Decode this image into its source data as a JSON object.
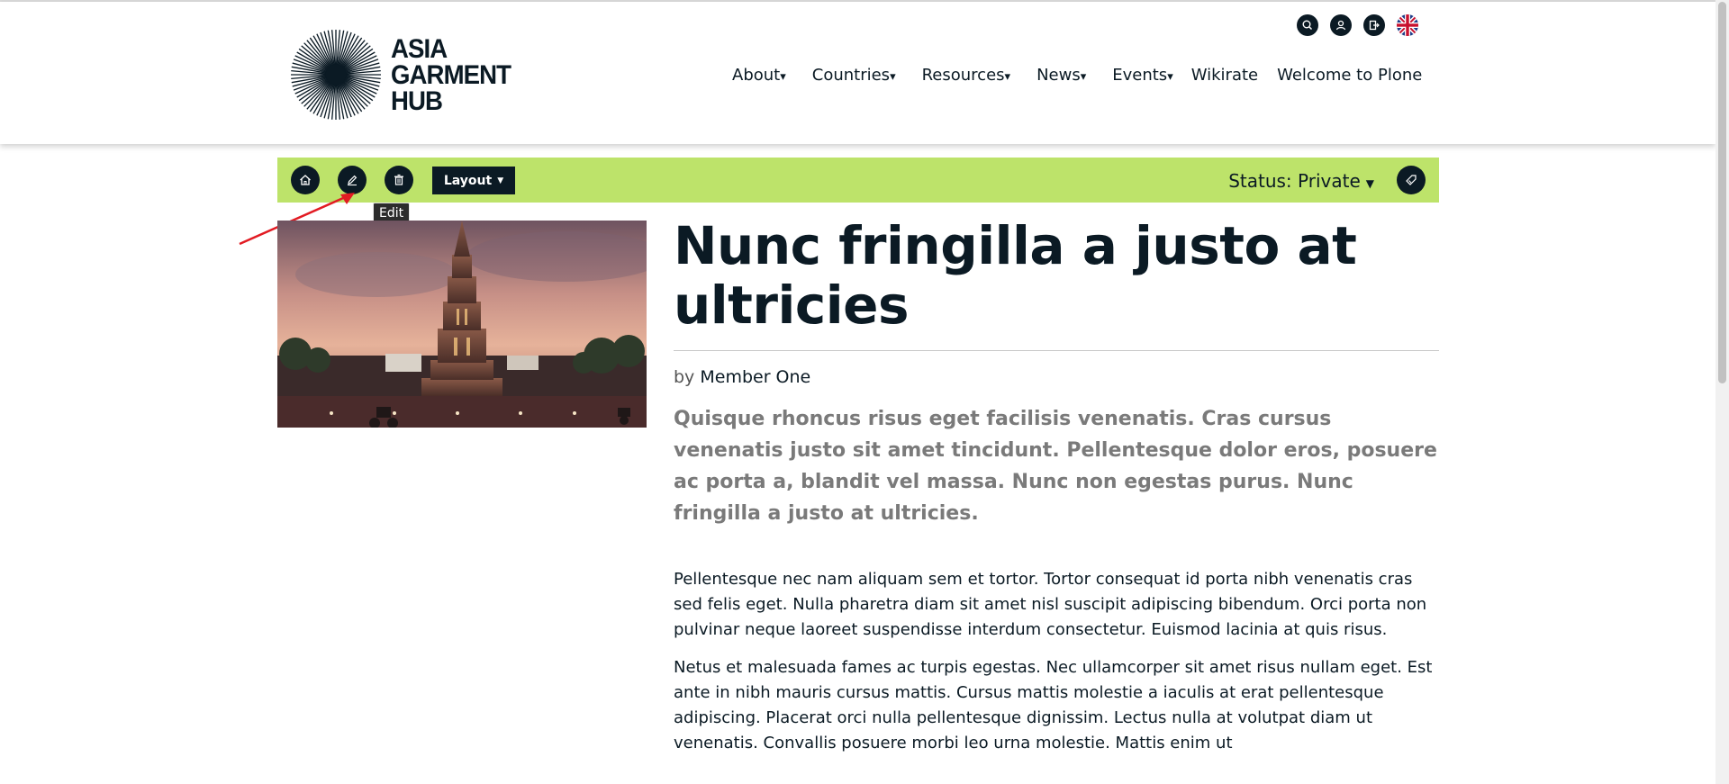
{
  "header": {
    "logo": {
      "lines": [
        "ASIA",
        "GARMENT",
        "HUB"
      ]
    },
    "utility_icons": [
      "search-icon",
      "user-icon",
      "logout-icon",
      "uk-flag-icon"
    ],
    "nav": [
      {
        "label": "About",
        "dropdown": true
      },
      {
        "label": "Countries",
        "dropdown": true
      },
      {
        "label": "Resources",
        "dropdown": true
      },
      {
        "label": "News",
        "dropdown": true
      },
      {
        "label": "Events",
        "dropdown": true
      },
      {
        "label": "Wikirate",
        "dropdown": false
      },
      {
        "label": "Welcome to Plone",
        "dropdown": false
      }
    ],
    "caret": "▾"
  },
  "toolbar": {
    "accent": "#bde36a",
    "buttons": [
      "home-icon",
      "edit-icon",
      "delete-icon"
    ],
    "layout_label": "Layout",
    "status_label": "Status: Private",
    "tooltip": "Edit"
  },
  "article": {
    "title": "Nunc fringilla a justo at ultricies",
    "by": "by",
    "author": "Member One",
    "lead": "Quisque rhoncus risus eget facilisis venenatis. Cras cursus venenatis justo sit amet tincidunt. Pellentesque dolor eros, posuere ac porta a, blandit vel massa. Nunc non egestas purus. Nunc fringilla a justo at ultricies.",
    "paragraphs": [
      "Pellentesque nec nam aliquam sem et tortor. Tortor consequat id porta nibh venenatis cras sed felis eget. Nulla pharetra diam sit amet nisl suscipit adipiscing bibendum. Orci porta non pulvinar neque laoreet suspendisse interdum consectetur. Euismod lacinia at quis risus.",
      "Netus et malesuada fames ac turpis egestas. Nec ullamcorper sit amet risus nullam eget. Est ante in nibh mauris cursus mattis. Cursus mattis molestie a iaculis at erat pellentesque adipiscing. Placerat orci nulla pellentesque dignissim. Lectus nulla at volutpat diam ut venenatis. Convallis posuere morbi leo urna molestie. Mattis enim ut"
    ]
  },
  "colors": {
    "dark": "#0b1a24",
    "toolbar": "#bde36a",
    "lead_text": "#7a7a7a"
  }
}
